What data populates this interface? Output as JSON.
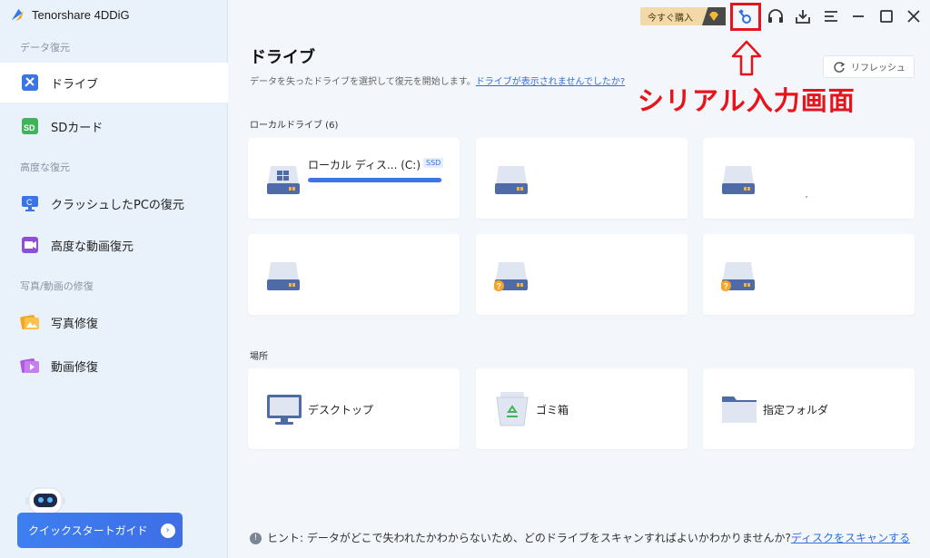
{
  "app": {
    "title": "Tenorshare 4DDiG"
  },
  "sidebar": {
    "sections": [
      {
        "label": "データ復元"
      },
      {
        "label": "高度な復元"
      },
      {
        "label": "写真/動画の修復"
      }
    ],
    "items": [
      {
        "label": "ドライブ",
        "icon": "drive-tools-icon"
      },
      {
        "label": "SDカード",
        "icon": "sd-card-icon"
      },
      {
        "label": "クラッシュしたPCの復元",
        "icon": "crashed-pc-icon"
      },
      {
        "label": "高度な動画復元",
        "icon": "video-recovery-icon"
      },
      {
        "label": "写真修復",
        "icon": "photo-repair-icon"
      },
      {
        "label": "動画修復",
        "icon": "video-repair-icon"
      }
    ],
    "guide_button": "クイックスタートガイド"
  },
  "titlebar": {
    "buy_label": "今すぐ購入",
    "icons": [
      "key-icon",
      "headset-icon",
      "download-icon",
      "menu-icon",
      "minimize-icon",
      "maximize-icon",
      "close-icon"
    ]
  },
  "main": {
    "title": "ドライブ",
    "subtitle": "データを失ったドライブを選択して復元を開始します。",
    "subtitle_link": "ドライブが表示されませんでしたか?",
    "refresh_label": "リフレッシュ",
    "annotation": "シリアル入力画面",
    "local_drives_label": "ローカルドライブ (6)",
    "drives": [
      {
        "name": "ローカル ディス... (C:)",
        "badge": "SSD",
        "usage_fraction": 0.99
      },
      {
        "name": ""
      },
      {
        "name": ""
      },
      {
        "name": ""
      },
      {
        "name": "",
        "warning": "?"
      },
      {
        "name": "",
        "warning": "?"
      }
    ],
    "locations_label": "場所",
    "locations": [
      {
        "name": "デスクトップ",
        "icon": "desktop-icon"
      },
      {
        "name": "ゴミ箱",
        "icon": "recycle-bin-icon"
      },
      {
        "name": "指定フォルダ",
        "icon": "folder-icon"
      }
    ],
    "hint_text": "ヒント:  データがどこで失われたかわからないため、どのドライブをスキャンすればよいかわかりませんか?",
    "hint_link": "ディスクをスキャンする"
  },
  "colors": {
    "accent": "#3f74e8",
    "annotation": "#e8141b",
    "sidebar_bg": "#e9f1fb"
  }
}
